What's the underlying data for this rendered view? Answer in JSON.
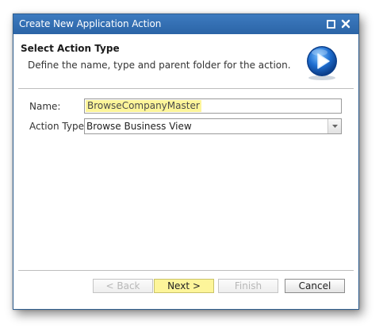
{
  "window": {
    "title": "Create New Application Action"
  },
  "header": {
    "heading": "Select Action Type",
    "description": "Define the name, type and parent folder for the action."
  },
  "form": {
    "name_label": "Name:",
    "name_value": "BrowseCompanyMaster",
    "type_label": "Action Type:",
    "type_value": "Browse Business View"
  },
  "buttons": {
    "back": "< Back",
    "next": "Next >",
    "finish": "Finish",
    "cancel": "Cancel"
  },
  "colors": {
    "titlebar": "#2b64a6",
    "highlight": "#fdf59a",
    "accent_icon": "#1f6fd1"
  },
  "icons": {
    "header_icon": "play-icon",
    "maximize": "maximize-icon",
    "close": "close-icon",
    "dropdown": "chevron-down-icon"
  }
}
